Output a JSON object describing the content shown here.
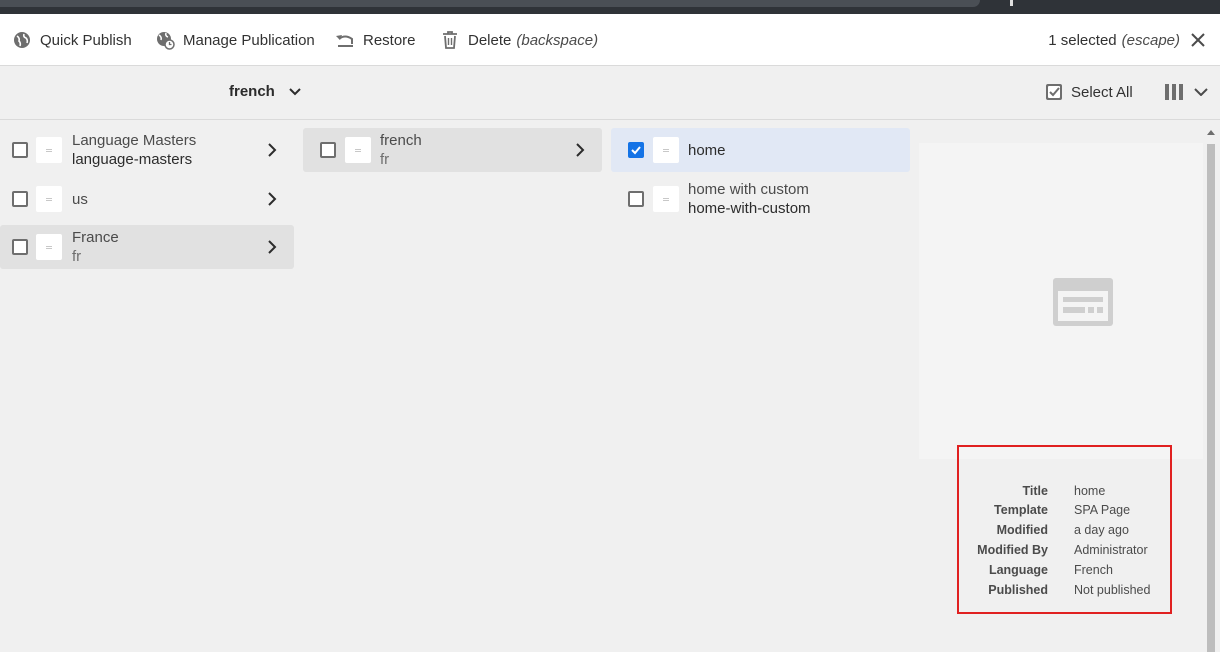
{
  "actions": {
    "quick_publish": "Quick Publish",
    "manage_publication": "Manage Publication",
    "restore": "Restore",
    "delete": "Delete",
    "delete_hint": "(backspace)",
    "selected_count": "1 selected",
    "selected_hint": "(escape)"
  },
  "toolbar": {
    "breadcrumb": "french",
    "select_all": "Select All"
  },
  "columns": [
    {
      "items": [
        {
          "title": "Language Masters",
          "name": "language-masters",
          "active": false
        },
        {
          "title": "us",
          "name": "",
          "active": false
        },
        {
          "title": "France",
          "name": "fr",
          "active": true
        }
      ]
    },
    {
      "items": [
        {
          "title": "french",
          "name": "fr",
          "active": true
        }
      ]
    },
    {
      "items": [
        {
          "title": "home",
          "name": "",
          "selected": true
        },
        {
          "title": "home with custom",
          "name": "home-with-custom",
          "selected": false
        }
      ]
    }
  ],
  "meta": {
    "title_label": "Title",
    "title_value": "home",
    "template_label": "Template",
    "template_value": "SPA Page",
    "modified_label": "Modified",
    "modified_value": "a day ago",
    "modified_by_label": "Modified By",
    "modified_by_value": "Administrator",
    "language_label": "Language",
    "language_value": "French",
    "published_label": "Published",
    "published_value": "Not published"
  },
  "colors": {
    "accent": "#1473e6",
    "highlight_border": "#e02020"
  }
}
